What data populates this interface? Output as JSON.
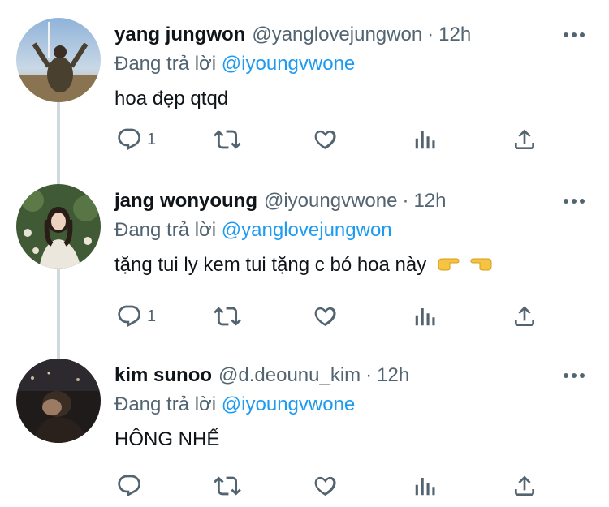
{
  "tweets": [
    {
      "name": "yang jungwon",
      "handle": "@yanglovejungwon",
      "separator": "·",
      "time": "12h",
      "replying_prefix": "Đang trả lời",
      "replying_to": "@iyoungvwone",
      "text": "hoa đẹp qtqd",
      "reply_count": "1"
    },
    {
      "name": "jang wonyoung",
      "handle": "@iyoungvwone",
      "separator": "·",
      "time": "12h",
      "replying_prefix": "Đang trả lời",
      "replying_to": "@yanglovejungwon",
      "text": "tặng tui ly kem tui tặng c bó hoa này",
      "emojis": [
        "backhand-index-pointing-right",
        "backhand-index-pointing-left"
      ],
      "reply_count": "1"
    },
    {
      "name": "kim sunoo",
      "handle": "@d.deounu_kim",
      "separator": "·",
      "time": "12h",
      "replying_prefix": "Đang trả lời",
      "replying_to": "@iyoungvwone",
      "text": "HÔNG NHẾ",
      "reply_count": ""
    }
  ],
  "colors": {
    "text": "#0f1419",
    "secondary": "#536471",
    "link": "#1d9bf0",
    "thread_line": "#cfd9de"
  },
  "icons": [
    "reply-icon",
    "retweet-icon",
    "like-icon",
    "analytics-icon",
    "share-icon",
    "more-icon"
  ]
}
